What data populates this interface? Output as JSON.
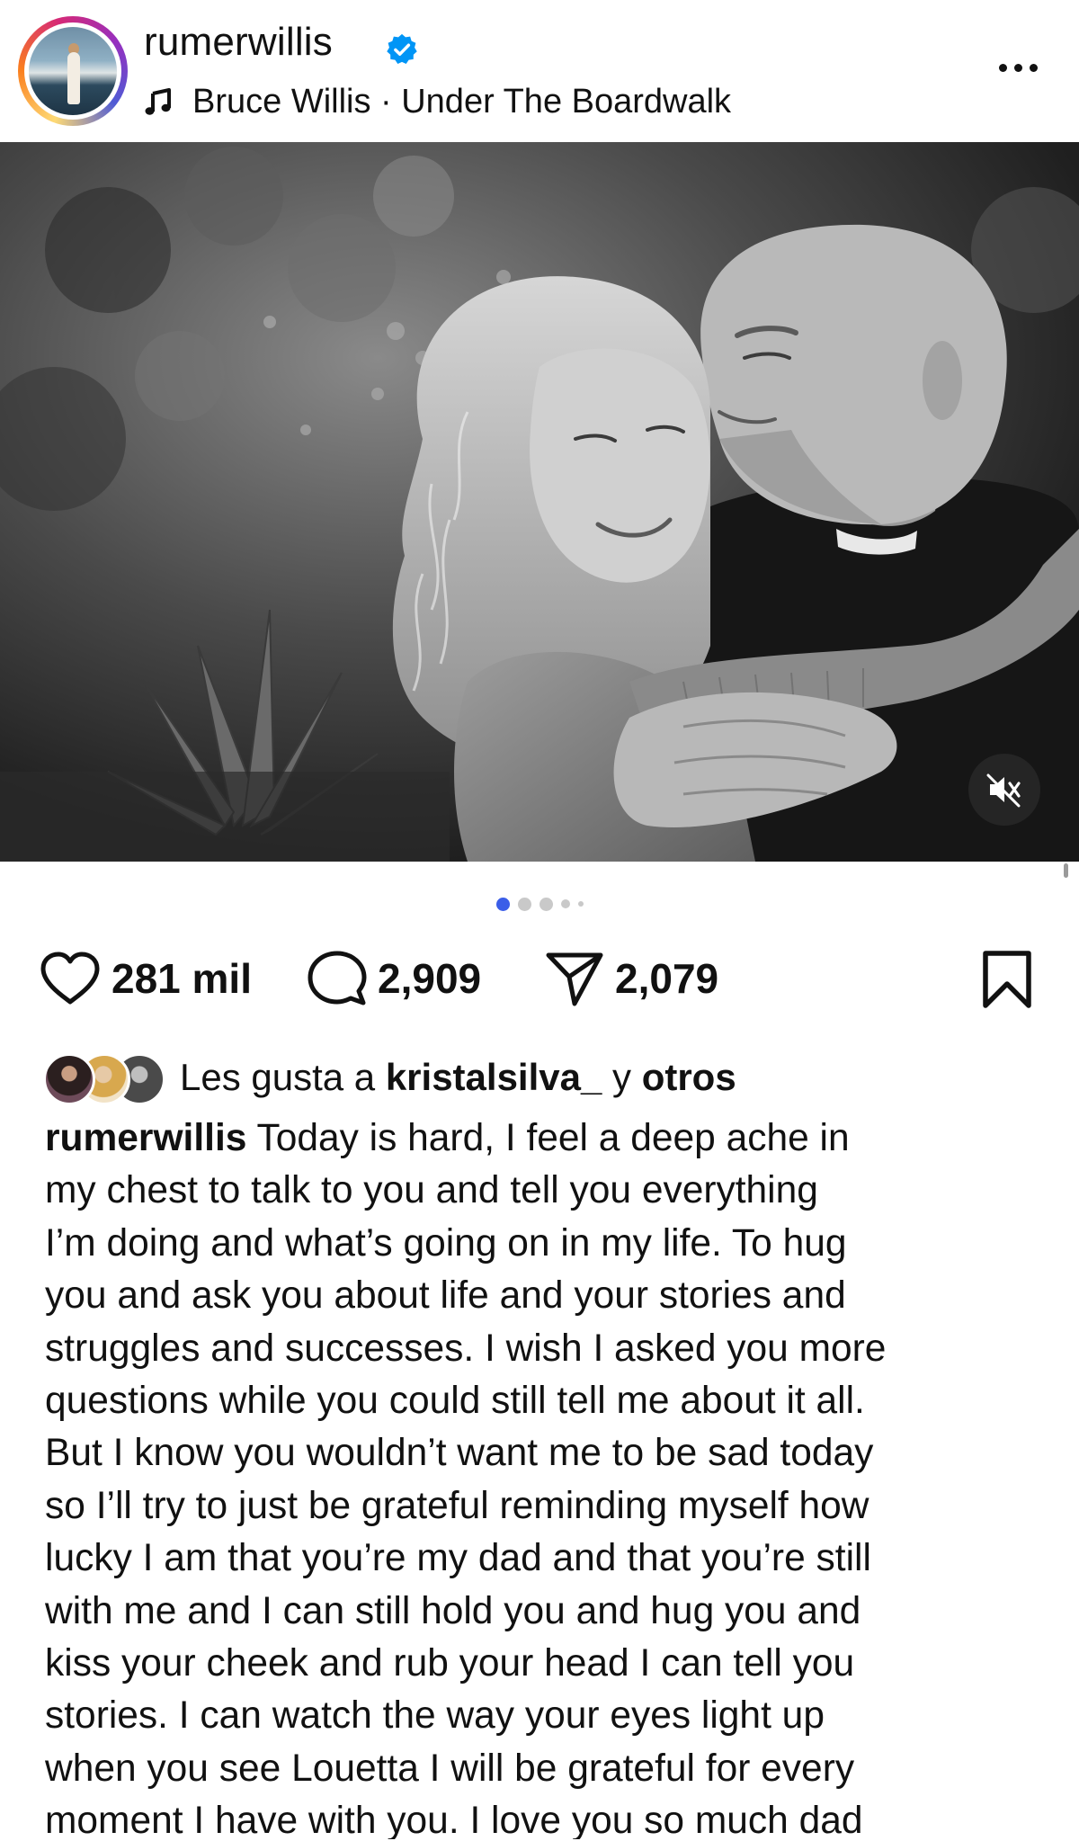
{
  "header": {
    "username": "rumerwillis",
    "verified": true,
    "music": "Bruce Willis · Under The Boardwalk",
    "avatar_icon": "profile-photo",
    "music_icon": "music-note-icon",
    "more_icon": "more-options-icon"
  },
  "media": {
    "description_icon": "photo",
    "mute_icon": "speaker-muted-icon",
    "carousel": {
      "count": 5,
      "active_index": 0,
      "active_color": "#3b5ee8"
    }
  },
  "actions": {
    "likes_count": "281 mil",
    "comments_count": "2,909",
    "shares_count": "2,079",
    "like_icon": "heart-icon",
    "comment_icon": "comment-bubble-icon",
    "share_icon": "paper-plane-icon",
    "save_icon": "bookmark-icon"
  },
  "liked_by": {
    "prefix": "Les gusta a ",
    "user": "kristalsilva_",
    "connector": " y ",
    "others": "otros"
  },
  "caption": {
    "author": "rumerwillis",
    "lines": [
      " Today is hard, I feel a deep ache in",
      "my chest to talk to you and tell you everything",
      "I’m doing and what’s going on in my life. To hug",
      "you and ask you about life and your stories and",
      "struggles and successes. I wish I asked you more",
      "questions while you could still tell me about it all.",
      "But I know you wouldn’t want me to be sad today",
      "so I’ll try to just be grateful reminding myself how",
      "lucky I am that you’re my dad and that you’re still",
      "with me and I can still hold you and hug you and",
      "kiss your cheek and rub your head I can tell you",
      "stories. I can watch the way your eyes light up",
      "when you see Louetta I will be grateful for every",
      "moment I have with you. I love you so much dad"
    ]
  },
  "colors": {
    "verified_blue": "#0095f6",
    "text": "#111111",
    "accent_dot": "#3b5ee8"
  }
}
